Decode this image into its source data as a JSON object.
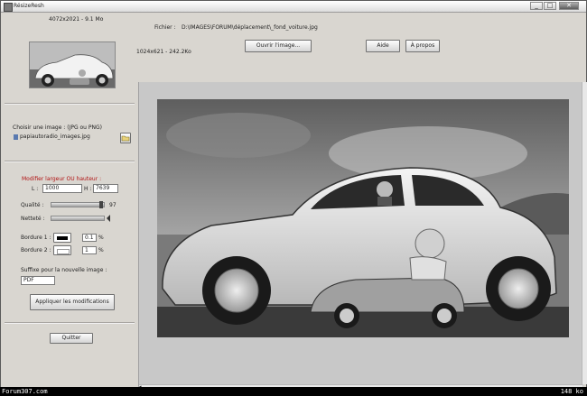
{
  "window": {
    "title": "RésizeResh",
    "min": "_",
    "max": "□",
    "close": "✕"
  },
  "left": {
    "dims_label": "4072x2021 - 9.1 Mo",
    "choose_label": "Choisir une image : (JPG ou PNG)",
    "file_value": "papiautoradio_images.jpg",
    "modify_label": "Modifier largeur OU hauteur :",
    "l_label": "L :",
    "l_value": "1000",
    "h_label": "H :",
    "h_value": "7639",
    "quality_label": "Qualité :",
    "quality_value": "97",
    "quality_level": 0.97,
    "sharpness_label": "Netteté :",
    "border1_label": "Bordure 1 :",
    "border1_value": "0.1",
    "border2_label": "Bordure 2 :",
    "border2_value": "1",
    "percent": "%",
    "suffix_label": "Suffixe pour la nouvelle image :",
    "suffix_value": "PDF",
    "apply_button": "Appliquer les modifications",
    "quit_button": "Quitter"
  },
  "main": {
    "file_label": "Fichier :",
    "file_path": "D:\\IMAGES\\FORUM\\déplacement\\_fond_voiture.jpg",
    "new_dims": "1024x621 - 242.2Ko",
    "open_button": "Ouvrir l'image...",
    "help_button": "Aide",
    "about_button": "À propos"
  },
  "bottombar": {
    "site": "Forum307.com",
    "size": "148 ko"
  },
  "colors": {
    "panel": "#d9d6d0",
    "accent_red": "#b01010"
  }
}
